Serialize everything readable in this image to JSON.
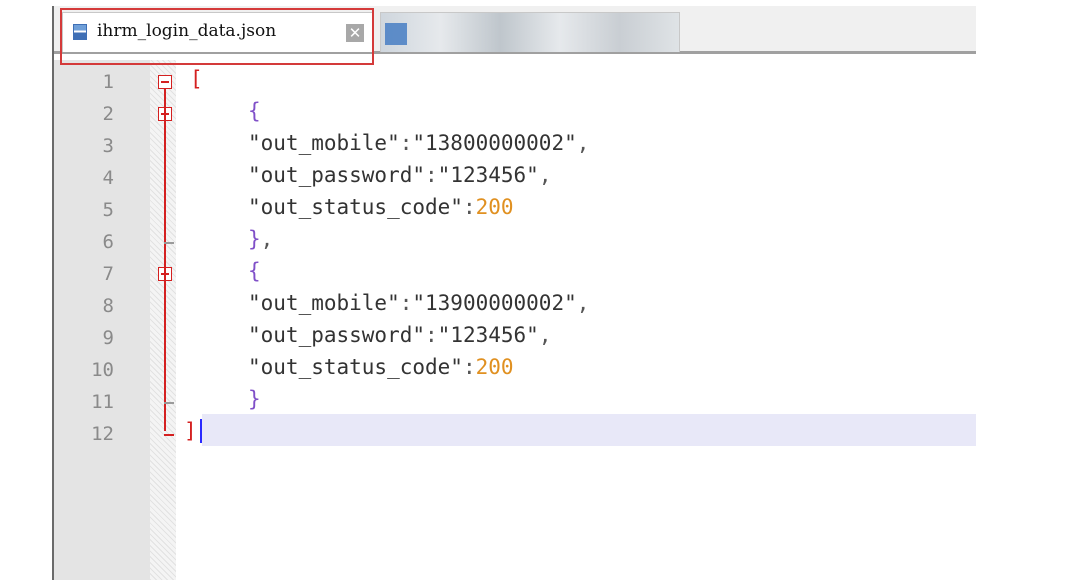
{
  "tabs": [
    {
      "label": "ihrm_login_data.json",
      "active": true,
      "icon": "save-icon",
      "close_icon": "✕"
    },
    {
      "label": "",
      "active": false,
      "icon": "file-icon",
      "blurred": true
    }
  ],
  "editor": {
    "line_numbers": [
      "1",
      "2",
      "3",
      "4",
      "5",
      "6",
      "7",
      "8",
      "9",
      "10",
      "11",
      "12"
    ],
    "lines": [
      {
        "indent": "",
        "parts": [
          {
            "t": "[",
            "c": "bracket"
          }
        ]
      },
      {
        "indent": "    ",
        "parts": [
          {
            "t": "{",
            "c": "brace"
          }
        ]
      },
      {
        "indent": "    ",
        "parts": [
          {
            "t": "\"out_mobile\"",
            "c": "key"
          },
          {
            "t": ":",
            "c": "colon"
          },
          {
            "t": "\"13800000002\"",
            "c": "str"
          },
          {
            "t": ",",
            "c": "comma"
          }
        ]
      },
      {
        "indent": "    ",
        "parts": [
          {
            "t": "\"out_password\"",
            "c": "key"
          },
          {
            "t": ":",
            "c": "colon"
          },
          {
            "t": "\"123456\"",
            "c": "str"
          },
          {
            "t": ",",
            "c": "comma"
          }
        ]
      },
      {
        "indent": "    ",
        "parts": [
          {
            "t": "\"out_status_code\"",
            "c": "key"
          },
          {
            "t": ":",
            "c": "colon"
          },
          {
            "t": "200",
            "c": "num"
          }
        ]
      },
      {
        "indent": "    ",
        "parts": [
          {
            "t": "}",
            "c": "brace"
          },
          {
            "t": ",",
            "c": "comma"
          }
        ]
      },
      {
        "indent": "    ",
        "parts": [
          {
            "t": "{",
            "c": "brace"
          }
        ]
      },
      {
        "indent": "    ",
        "parts": [
          {
            "t": "\"out_mobile\"",
            "c": "key"
          },
          {
            "t": ":",
            "c": "colon"
          },
          {
            "t": "\"13900000002\"",
            "c": "str"
          },
          {
            "t": ",",
            "c": "comma"
          }
        ]
      },
      {
        "indent": "    ",
        "parts": [
          {
            "t": "\"out_password\"",
            "c": "key"
          },
          {
            "t": ":",
            "c": "colon"
          },
          {
            "t": "\"123456\"",
            "c": "str"
          },
          {
            "t": ",",
            "c": "comma"
          }
        ]
      },
      {
        "indent": "    ",
        "parts": [
          {
            "t": "\"out_status_code\"",
            "c": "key"
          },
          {
            "t": ":",
            "c": "colon"
          },
          {
            "t": "200",
            "c": "num"
          }
        ]
      },
      {
        "indent": "    ",
        "parts": [
          {
            "t": "}",
            "c": "brace"
          }
        ]
      },
      {
        "indent": "",
        "parts": [
          {
            "t": "]",
            "c": "bracket"
          }
        ]
      }
    ],
    "current_line": 12
  },
  "colors": {
    "fold_marker": "#d42020",
    "brace": "#8050c8",
    "number": "#e09020",
    "current_line_bg": "#e8e8f8",
    "highlight_box": "#d43a3a"
  }
}
